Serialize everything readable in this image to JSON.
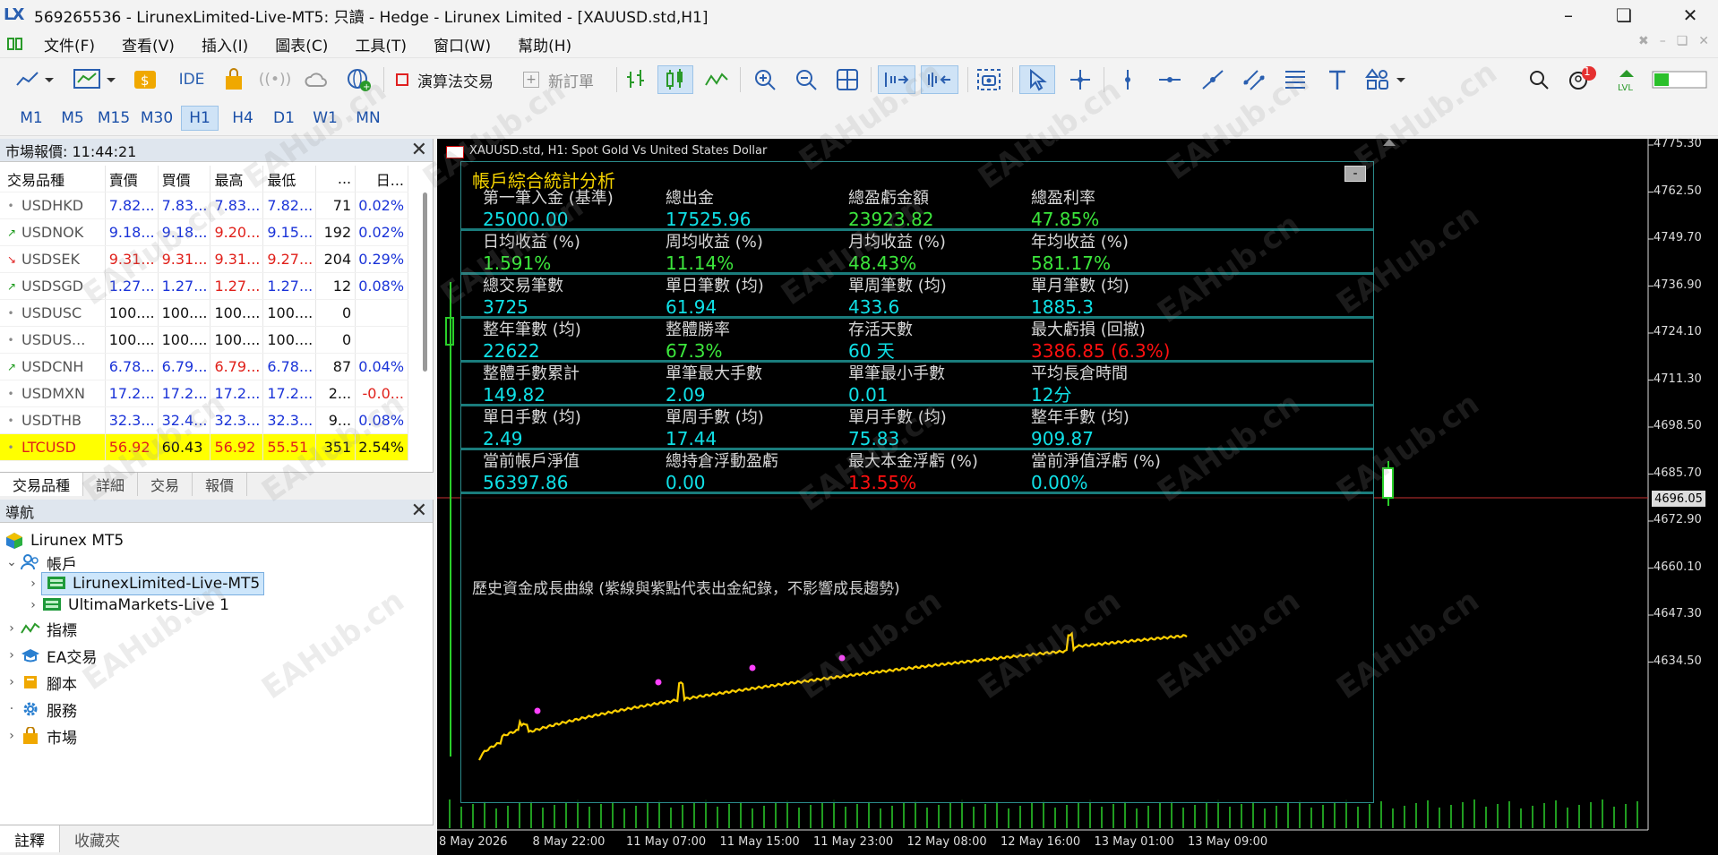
{
  "window": {
    "title": "569265536 - LirunexLimited-Live-MT5: 只讀 - Hedge - Lirunex Limited - [XAUUSD.std,H1]",
    "logo": "LX"
  },
  "menu": [
    "文件(F)",
    "查看(V)",
    "插入(I)",
    "圖表(C)",
    "工具(T)",
    "窗口(W)",
    "幫助(H)"
  ],
  "toolbar": {
    "ide_label": "IDE",
    "algo_label": "演算法交易",
    "new_order_label": "新訂單",
    "notification_count": "1"
  },
  "timeframes": [
    "M1",
    "M5",
    "M15",
    "M30",
    "H1",
    "H4",
    "D1",
    "W1",
    "MN"
  ],
  "active_timeframe": "H1",
  "market_watch": {
    "title": "市場報價: 11:44:21",
    "columns": [
      "交易品種",
      "賣價",
      "買價",
      "最高",
      "最低",
      "...",
      "日..."
    ],
    "rows": [
      {
        "dir": "•",
        "symbol": "USDHKD",
        "bid": "7.82...",
        "ask": "7.83...",
        "high": "7.83...",
        "low": "7.82...",
        "spread": "71",
        "change": "0.02%",
        "tone": "blue"
      },
      {
        "dir": "↗",
        "symbol": "USDNOK",
        "bid": "9.18...",
        "ask": "9.18...",
        "high": "9.20...",
        "low": "9.15...",
        "spread": "192",
        "change": "0.02%",
        "tone": "blue"
      },
      {
        "dir": "↘",
        "symbol": "USDSEK",
        "bid": "9.31...",
        "ask": "9.31...",
        "high": "9.31...",
        "low": "9.27...",
        "spread": "204",
        "change": "0.29%",
        "tone": "red"
      },
      {
        "dir": "↗",
        "symbol": "USDSGD",
        "bid": "1.27...",
        "ask": "1.27...",
        "high": "1.27...",
        "low": "1.27...",
        "spread": "12",
        "change": "0.08%",
        "tone": "blue"
      },
      {
        "dir": "•",
        "symbol": "USDUSC",
        "bid": "100....",
        "ask": "100....",
        "high": "100....",
        "low": "100....",
        "spread": "0",
        "change": "",
        "tone": "black"
      },
      {
        "dir": "•",
        "symbol": "USDUS...",
        "bid": "100....",
        "ask": "100....",
        "high": "100....",
        "low": "100....",
        "spread": "0",
        "change": "",
        "tone": "black"
      },
      {
        "dir": "↗",
        "symbol": "USDCNH",
        "bid": "6.78...",
        "ask": "6.79...",
        "high": "6.79...",
        "low": "6.78...",
        "spread": "87",
        "change": "0.04%",
        "tone": "blue"
      },
      {
        "dir": "•",
        "symbol": "USDMXN",
        "bid": "17.2...",
        "ask": "17.2...",
        "high": "17.2...",
        "low": "17.2...",
        "spread": "2...",
        "change": "-0.0...",
        "tone": "blue"
      },
      {
        "dir": "•",
        "symbol": "USDTHB",
        "bid": "32.3...",
        "ask": "32.4...",
        "high": "32.3...",
        "low": "32.3...",
        "spread": "9...",
        "change": "0.08%",
        "tone": "blue"
      },
      {
        "dir": "•",
        "symbol": "LTCUSD",
        "bid": "56.92",
        "ask": "60.43",
        "high": "56.92",
        "low": "55.51",
        "spread": "351",
        "change": "2.54%",
        "tone": "highlight"
      }
    ],
    "tabs": [
      "交易品種",
      "詳細",
      "交易",
      "報價"
    ]
  },
  "navigator": {
    "title": "導航",
    "root": "Lirunex MT5",
    "accounts": "帳戶",
    "account_1": "LirunexLimited-Live-MT5",
    "account_2": "UltimaMarkets-Live 1",
    "indicators": "指標",
    "ea": "EA交易",
    "scripts": "腳本",
    "services": "服務",
    "market": "市場"
  },
  "bottom_tabs": [
    "註釋",
    "收藏夾"
  ],
  "chart": {
    "symbol_label": "XAUUSD.std, H1:  Spot Gold Vs United States Dollar",
    "current_price": "4696.05",
    "y_ticks": [
      "4775.30",
      "4762.50",
      "4749.70",
      "4736.90",
      "4724.10",
      "4711.30",
      "4698.50",
      "4685.70",
      "4672.90",
      "4660.10",
      "4647.30",
      "4634.50"
    ],
    "x_ticks": [
      "8 May 2026",
      "8 May 22:00",
      "11 May 07:00",
      "11 May 15:00",
      "11 May 23:00",
      "12 May 08:00",
      "12 May 16:00",
      "13 May 01:00",
      "13 May 09:00"
    ],
    "watermark": "EAHub.cn"
  },
  "stats": {
    "title": "帳戶綜合統計分析",
    "minimize_label": "-",
    "rows": [
      [
        {
          "label": "第一筆入金 (基準)",
          "value": "25000.00",
          "color": "cyan"
        },
        {
          "label": "總出金",
          "value": "17525.96",
          "color": "cyan"
        },
        {
          "label": "總盈虧金額",
          "value": "23923.82",
          "color": "green"
        },
        {
          "label": "總盈利率",
          "value": "47.85%",
          "color": "green"
        }
      ],
      [
        {
          "label": "日均收益 (%)",
          "value": "1.591%",
          "color": "green"
        },
        {
          "label": "周均收益 (%)",
          "value": "11.14%",
          "color": "green"
        },
        {
          "label": "月均收益 (%)",
          "value": "48.43%",
          "color": "green"
        },
        {
          "label": "年均收益 (%)",
          "value": "581.17%",
          "color": "green"
        }
      ],
      [
        {
          "label": "總交易筆數",
          "value": "3725",
          "color": "cyan"
        },
        {
          "label": "單日筆數 (均)",
          "value": "61.94",
          "color": "cyan"
        },
        {
          "label": "單周筆數 (均)",
          "value": "433.6",
          "color": "cyan"
        },
        {
          "label": "單月筆數 (均)",
          "value": "1885.3",
          "color": "cyan"
        }
      ],
      [
        {
          "label": "整年筆數 (均)",
          "value": "22622",
          "color": "cyan"
        },
        {
          "label": "整體勝率",
          "value": "67.3%",
          "color": "green"
        },
        {
          "label": "存活天數",
          "value": "60 天",
          "color": "cyan"
        },
        {
          "label": "最大虧損 (回撤)",
          "value": "3386.85 (6.3%)",
          "color": "red"
        }
      ],
      [
        {
          "label": "整體手數累計",
          "value": "149.82",
          "color": "cyan"
        },
        {
          "label": "單筆最大手數",
          "value": "2.09",
          "color": "cyan"
        },
        {
          "label": "單筆最小手數",
          "value": "0.01",
          "color": "cyan"
        },
        {
          "label": "平均長倉時間",
          "value": "12分",
          "color": "cyan"
        }
      ],
      [
        {
          "label": "單日手數 (均)",
          "value": "2.49",
          "color": "cyan"
        },
        {
          "label": "單周手數 (均)",
          "value": "17.44",
          "color": "cyan"
        },
        {
          "label": "單月手數 (均)",
          "value": "75.83",
          "color": "cyan"
        },
        {
          "label": "整年手數 (均)",
          "value": "909.87",
          "color": "cyan"
        }
      ],
      [
        {
          "label": "當前帳戶淨值",
          "value": "56397.86",
          "color": "cyan"
        },
        {
          "label": "總持倉浮動盈虧",
          "value": "0.00",
          "color": "cyan"
        },
        {
          "label": "最大本金浮虧 (%)",
          "value": "13.55%",
          "color": "red"
        },
        {
          "label": "當前淨值浮虧 (%)",
          "value": "0.00%",
          "color": "cyan"
        }
      ]
    ],
    "curve_label": "歷史資金成長曲線 (紫線與紫點代表出金紀錄，不影響成長趨勢)"
  },
  "colors": {
    "cyan": "#10e0e6",
    "green": "#3ce63c",
    "red": "#ff1010",
    "gold": "#f5d300",
    "curve": "#ffd000",
    "withdrawal_dot": "#ff40ff",
    "price_line": "#c83232"
  }
}
